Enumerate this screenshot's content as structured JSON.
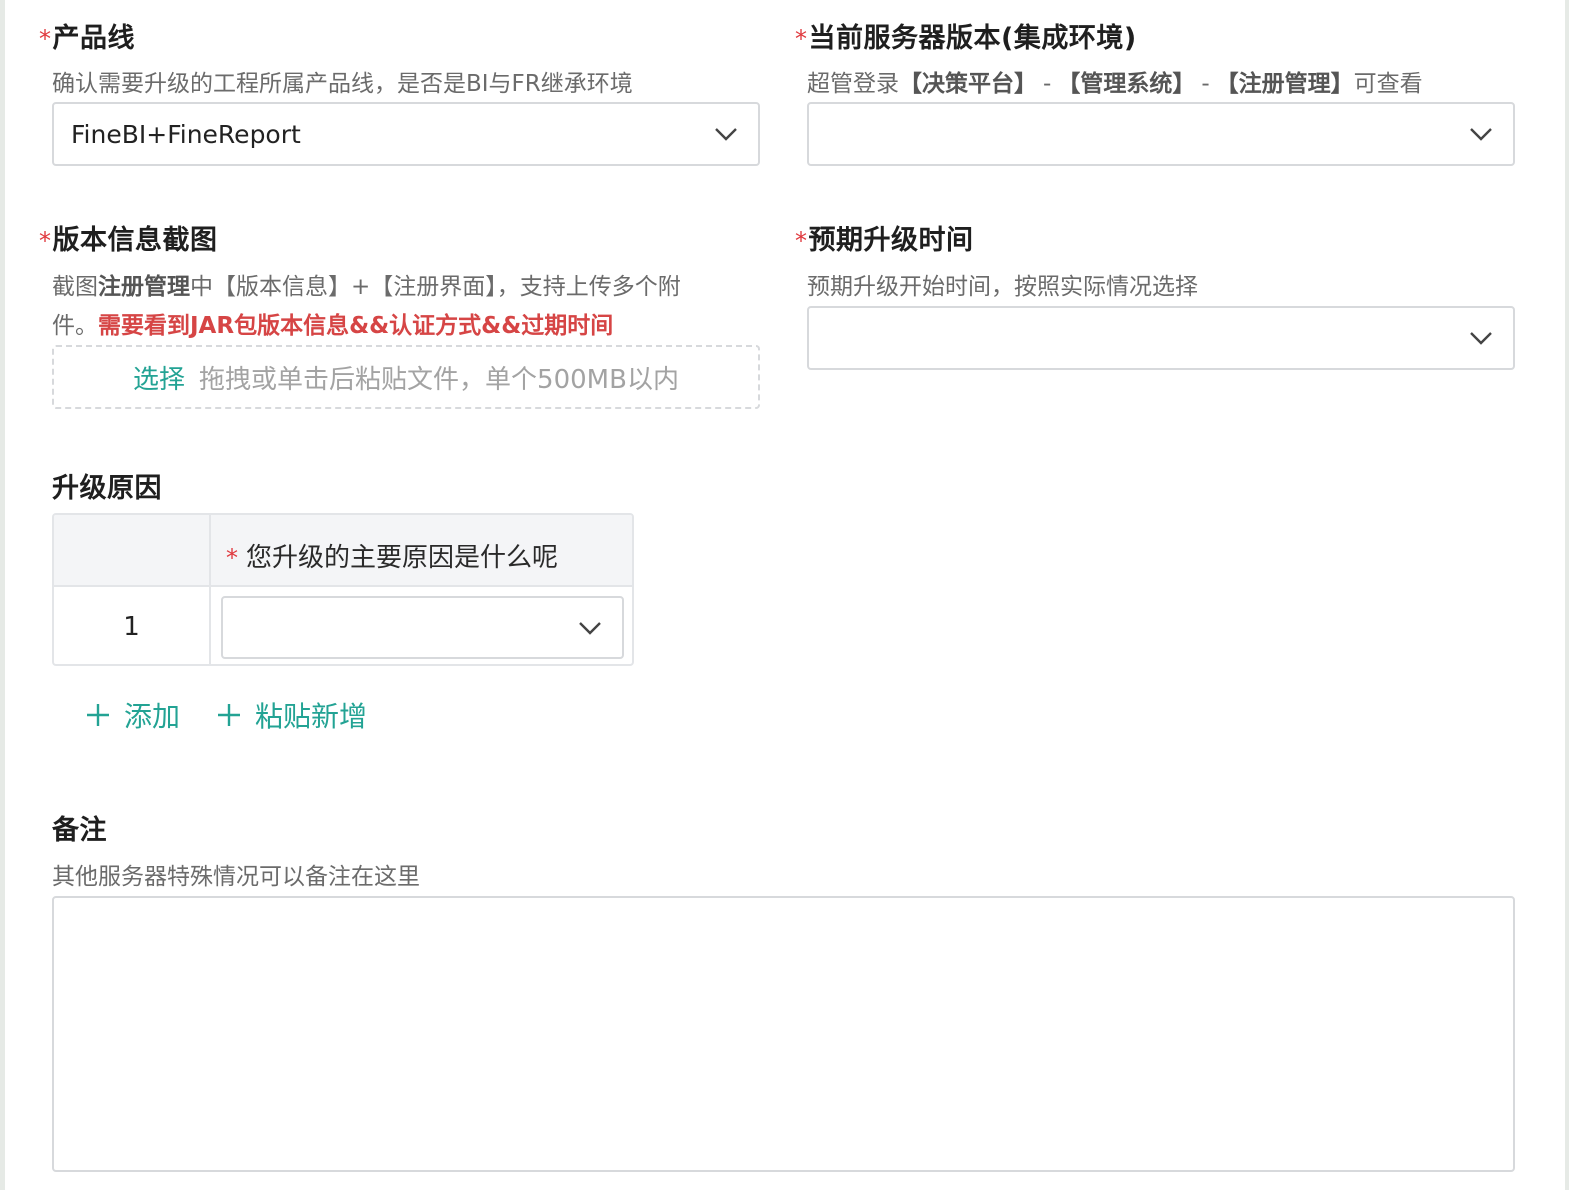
{
  "product_line": {
    "required_mark": "*",
    "label": "产品线",
    "description": "确认需要升级的工程所属产品线，是否是BI与FR继承环境",
    "value": "FineBI+FineReport"
  },
  "server_version": {
    "required_mark": "*",
    "label": "当前服务器版本(集成环境)",
    "description_parts": [
      "超管登录",
      "【决策平台】",
      "-",
      "【管理系统】",
      "-",
      "【注册管理】",
      "可查看"
    ],
    "value": ""
  },
  "version_screenshot": {
    "required_mark": "*",
    "label": "版本信息截图",
    "description_parts": [
      "截图",
      "注册管理",
      "中【版本信息】+【注册界面】，支持上传多个附"
    ],
    "description_line2": "件。",
    "warning": "需要看到JAR包版本信息&&认证方式&&过期时间",
    "upload_pick": "选择",
    "upload_hint": "拖拽或单击后粘贴文件，单个500MB以内"
  },
  "upgrade_time": {
    "required_mark": "*",
    "label": "预期升级时间",
    "description": "预期升级开始时间，按照实际情况选择",
    "value": ""
  },
  "upgrade_reason": {
    "label": "升级原因",
    "table": {
      "header_required_mark": "*",
      "header": "您升级的主要原因是什么呢",
      "rows": [
        {
          "index": "1",
          "value": ""
        }
      ]
    },
    "add_label": "添加",
    "paste_add_label": "粘贴新增"
  },
  "remarks": {
    "label": "备注",
    "description": "其他服务器特殊情况可以备注在这里",
    "value": ""
  },
  "colors": {
    "accent": "#23a394",
    "required": "#e0393e",
    "warning": "#d64545",
    "border": "#d7d9dc"
  },
  "icons": {
    "dropdown": "chevron-down-icon",
    "add": "plus-icon"
  }
}
